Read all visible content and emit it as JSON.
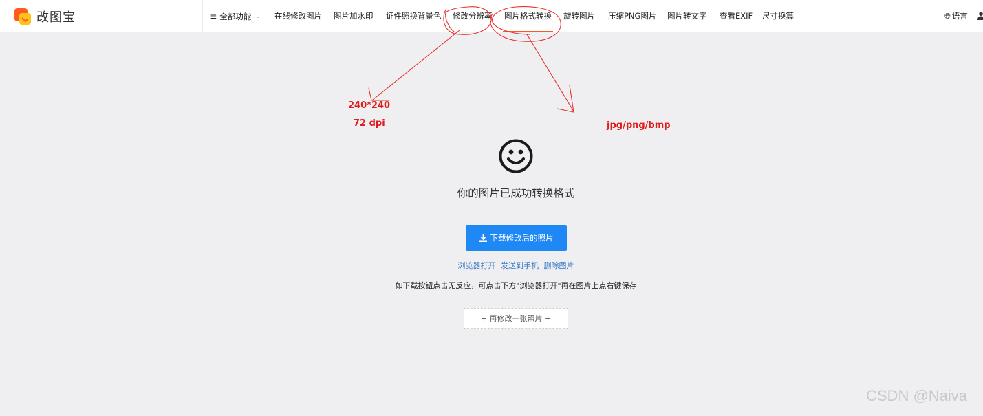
{
  "header": {
    "logo_text": "改图宝",
    "all_functions": "全部功能",
    "nav_items": [
      {
        "label": "在线修改图片"
      },
      {
        "label": "图片加水印"
      },
      {
        "label": "证件照换背景色"
      },
      {
        "label": "修改分辨率"
      },
      {
        "label": "图片格式转换",
        "active": true
      },
      {
        "label": "旋转图片"
      },
      {
        "label": "压缩PNG图片"
      },
      {
        "label": "图片转文字"
      },
      {
        "label": "查看EXIF"
      },
      {
        "label": "尺寸换算"
      }
    ],
    "language": "语言"
  },
  "annotations": {
    "size_note": "240*240",
    "dpi_note": "72 dpi",
    "format_note": "jpg/png/bmp",
    "color": "#e01b1b"
  },
  "main": {
    "success_message": "你的图片已成功转换格式",
    "download_button": "下载修改后的照片",
    "links": {
      "open_in_browser": "浏览器打开",
      "send_to_phone": "发送到手机",
      "delete_image": "删除图片"
    },
    "hint": "如下载按钮点击无反应，可点击下方\"浏览器打开\"再在图片上点右键保存",
    "modify_again": "+ 再修改一张照片 +"
  },
  "watermark": "CSDN @Naiva",
  "colors": {
    "accent": "#1e88f5",
    "active_underline": "#ff5a1f",
    "link": "#3a7bc8",
    "background": "#efeff1"
  }
}
